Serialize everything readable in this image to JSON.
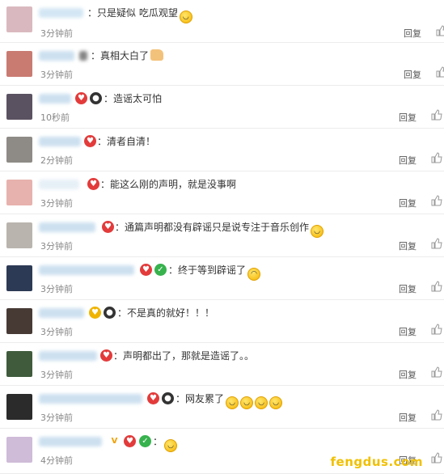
{
  "comments": [
    {
      "text": "只是疑似 吃瓜观望",
      "emojis": [
        "smile-emoji"
      ],
      "time": "3分钟前",
      "reply": "回复",
      "avatar_color": "#d9b9bf"
    },
    {
      "text": "真相大白了",
      "emojis": [
        "thumbs-up-emoji"
      ],
      "time": "3分钟前",
      "reply": "回复",
      "avatar_color": "#c97b72"
    },
    {
      "text": "造谣太可怕",
      "emojis": [],
      "time": "10秒前",
      "reply": "回复",
      "avatar_color": "#5b5261"
    },
    {
      "text": "清者自清！",
      "emojis": [],
      "time": "2分钟前",
      "reply": "回复",
      "avatar_color": "#8e8b86"
    },
    {
      "text": "能这么刚的声明，就是没事啊",
      "emojis": [],
      "time": "3分钟前",
      "reply": "回复",
      "avatar_color": "#e7b2ad"
    },
    {
      "text": "通篇声明都没有辟谣只是说专注于音乐创作",
      "emojis": [
        "sweat-emoji"
      ],
      "time": "3分钟前",
      "reply": "回复",
      "avatar_color": "#b9b4ad"
    },
    {
      "text": "终于等到辟谣了",
      "emojis": [
        "crying-emoji"
      ],
      "time": "3分钟前",
      "reply": "回复",
      "avatar_color": "#2d3a55"
    },
    {
      "text": "不是真的就好！！！",
      "emojis": [],
      "time": "3分钟前",
      "reply": "回复",
      "avatar_color": "#473a35"
    },
    {
      "text": "声明都出了，那就是造谣了。。",
      "emojis": [],
      "time": "3分钟前",
      "reply": "回复",
      "avatar_color": "#3f5b3c"
    },
    {
      "text": "网友累了",
      "emojis": [
        "smile-emoji",
        "smile-emoji",
        "smile-emoji",
        "smile-emoji"
      ],
      "time": "3分钟前",
      "reply": "回复",
      "avatar_color": "#2b2b2b"
    },
    {
      "text": "",
      "emojis": [
        "smile-emoji"
      ],
      "time": "4分钟前",
      "reply": "回复",
      "avatar_color": "#cfbcd8"
    }
  ],
  "watermark": "fengdus.com",
  "colors": {
    "badge_red": "#e33b3b",
    "badge_green": "#37b24d",
    "like_gray": "#999999"
  }
}
